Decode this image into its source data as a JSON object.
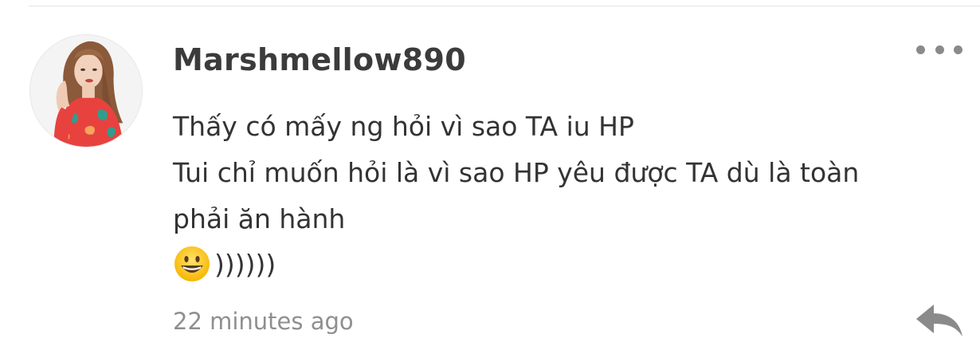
{
  "comment": {
    "username": "Marshmellow890",
    "body_lines": [
      "Thấy có mấy ng hỏi vì sao TA iu HP",
      "Tui chỉ muốn hỏi là vì sao HP yêu được TA dù là toàn",
      "phải ăn hành"
    ],
    "emoji_icon": "grinning-face-emoji",
    "emoji_suffix": "))))))",
    "timestamp": "22 minutes ago"
  },
  "icons": {
    "more": "more-horizontal-icon",
    "reply": "reply-arrow-icon",
    "avatar": "user-avatar-photo"
  },
  "colors": {
    "username": "#3b3b3b",
    "text": "#333333",
    "timestamp": "#8f8f8f",
    "icon": "#8a8a8a"
  }
}
